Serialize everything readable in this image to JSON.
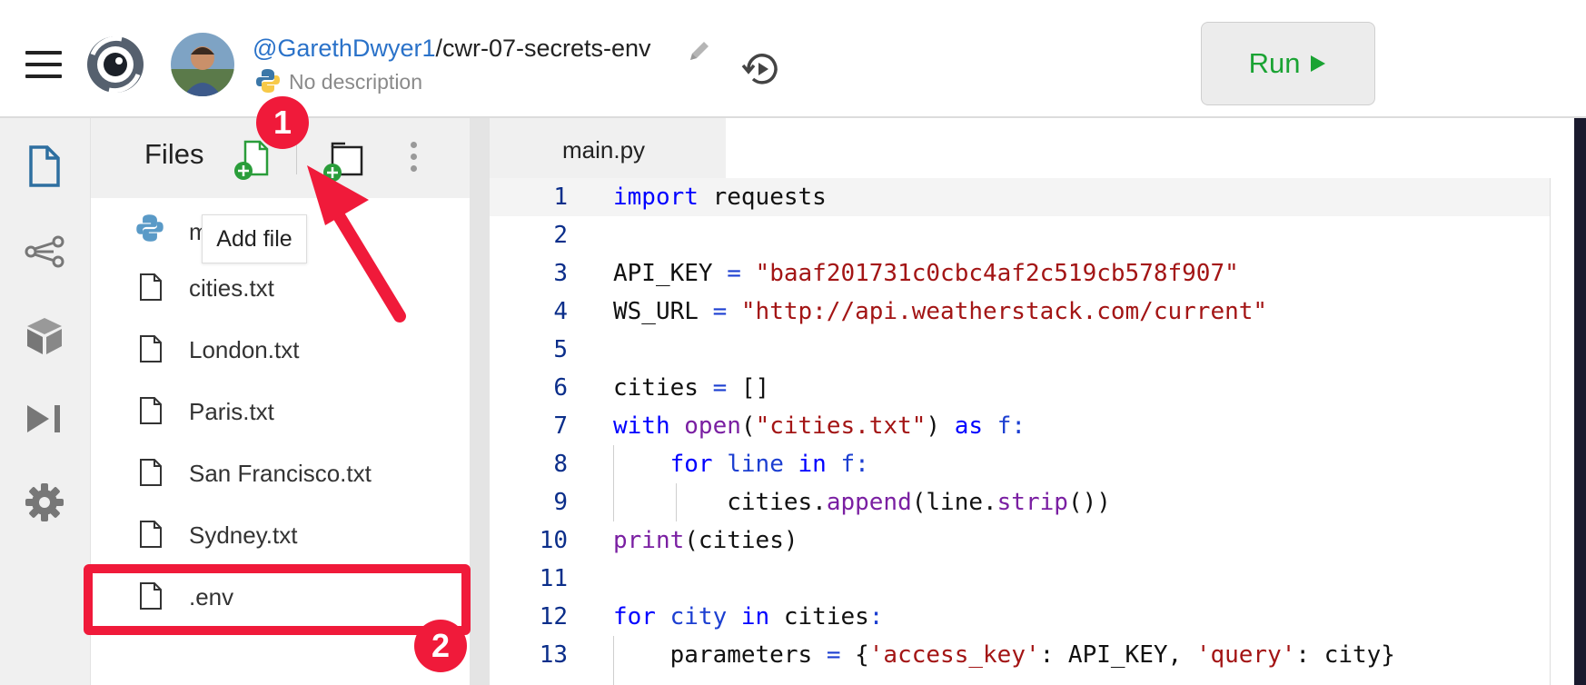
{
  "header": {
    "username": "@GarethDwyer1",
    "repo": "/cwr-07-secrets-env",
    "description": "No description",
    "run_label": "Run",
    "icons": [
      "hamburger-menu-icon",
      "replit-logo-icon",
      "avatar",
      "pencil-icon",
      "python-icon",
      "history-icon",
      "play-icon"
    ]
  },
  "rail": {
    "icons": [
      "files-icon",
      "share-icon",
      "packages-icon",
      "debugger-icon",
      "settings-icon"
    ]
  },
  "files": {
    "title": "Files",
    "tooltip": "Add file",
    "items": [
      {
        "label": "main.py",
        "visible": "m"
      },
      {
        "label": "cities.txt"
      },
      {
        "label": "London.txt"
      },
      {
        "label": "Paris.txt"
      },
      {
        "label": "San Francisco.txt"
      },
      {
        "label": "Sydney.txt"
      },
      {
        "label": ".env"
      }
    ]
  },
  "editor": {
    "tab": "main.py",
    "line_numbers": [
      "1",
      "2",
      "3",
      "4",
      "5",
      "6",
      "7",
      "8",
      "9",
      "10",
      "11",
      "12",
      "13"
    ]
  },
  "annotations": {
    "badge1": "1",
    "badge2": "2",
    "accent": "#f01a3a"
  },
  "colors": {
    "run_text": "#1aa333",
    "keyword": "#0000ff",
    "string": "#a31515",
    "function": "#7a1fa2"
  }
}
